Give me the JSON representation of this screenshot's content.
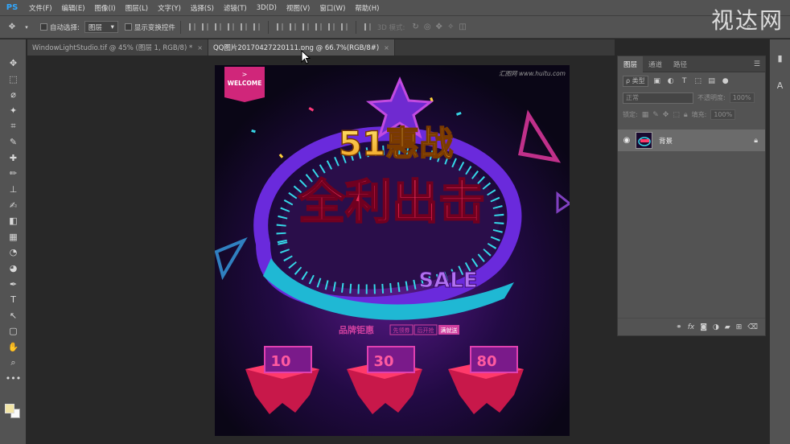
{
  "app": {
    "logo": "PS"
  },
  "menu": [
    "文件(F)",
    "编辑(E)",
    "图像(I)",
    "图层(L)",
    "文字(Y)",
    "选择(S)",
    "滤镜(T)",
    "3D(D)",
    "视图(V)",
    "窗口(W)",
    "帮助(H)"
  ],
  "options": {
    "auto_select_label": "自动选择:",
    "auto_select_value": "图层",
    "transform_label": "显示变换控件",
    "mode_3d_label": "3D 模式:"
  },
  "watermark": "视达网",
  "tabs": [
    {
      "title": "WindowLightStudio.tif @ 45% (图层 1, RGB/8) *",
      "close": "×"
    },
    {
      "title": "QQ图片20170427220111.png @ 66.7%(RGB/8#)",
      "close": "×"
    }
  ],
  "tools": [
    "move-tool",
    "marquee-tool",
    "lasso-tool",
    "magic-wand-tool",
    "crop-tool",
    "eyedropper-tool",
    "healing-tool",
    "brush-tool",
    "stamp-tool",
    "history-brush-tool",
    "eraser-tool",
    "gradient-tool",
    "blur-tool",
    "dodge-tool",
    "pen-tool",
    "type-tool",
    "path-select-tool",
    "shape-tool",
    "hand-tool",
    "zoom-tool",
    "more-tools"
  ],
  "tool_glyphs": [
    "✥",
    "⬚",
    "⌀",
    "✦",
    "⌗",
    "✎",
    "✚",
    "✏",
    "⊥",
    "✍",
    "◧",
    "▦",
    "◔",
    "◕",
    "✒",
    "T",
    "↖",
    "▢",
    "✋",
    "⌕",
    "•••"
  ],
  "layers_panel": {
    "tabs": [
      "图层",
      "通道",
      "路径"
    ],
    "filter_kind": "ρ 类型",
    "blend_mode": "正常",
    "opacity_label": "不透明度:",
    "opacity_value": "100%",
    "lock_label": "锁定:",
    "fill_label": "填充:",
    "fill_value": "100%",
    "layer": {
      "name": "背景"
    }
  },
  "artwork": {
    "welcome": "WELCOME",
    "watermark": "汇图网 www.huitu.com",
    "title_top": "51惠战",
    "title_main": "全利出击",
    "sale": "SALE",
    "subtitle": "品牌钜惠",
    "tags": [
      "先领券",
      "后开抢",
      "满就送"
    ],
    "coupons": [
      "10",
      "30",
      "80"
    ]
  },
  "colors": {
    "ps_blue": "#31a8ff",
    "ui_gray": "#535353"
  }
}
